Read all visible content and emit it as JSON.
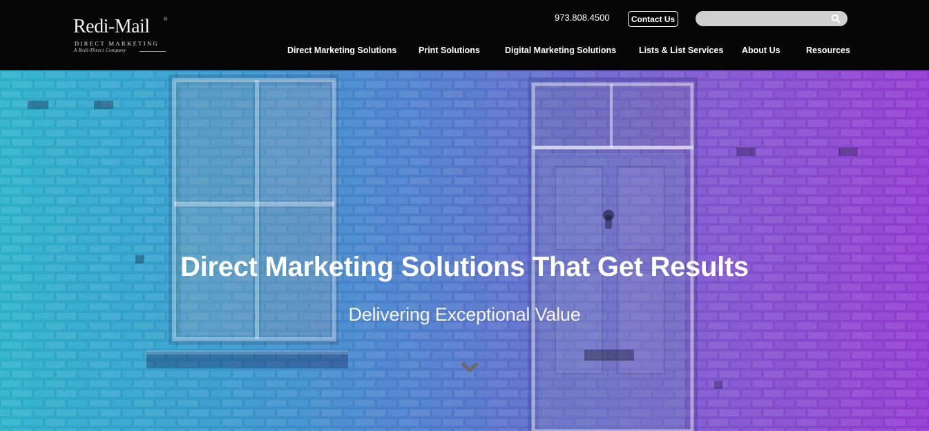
{
  "brand": {
    "name": "Redi-Mail",
    "registered": "®",
    "tagline": "DIRECT MARKETING",
    "parent": "A Redi-Direct Company"
  },
  "header": {
    "phone": "973.808.4500",
    "contact_label": "Contact Us",
    "search_placeholder": ""
  },
  "nav": [
    {
      "label": "Direct Marketing Solutions"
    },
    {
      "label": "Print Solutions"
    },
    {
      "label": "Digital Marketing Solutions"
    },
    {
      "label": "Lists & List Services"
    },
    {
      "label": "About Us"
    },
    {
      "label": "Resources"
    }
  ],
  "hero": {
    "title": "Direct Marketing Solutions That Get Results",
    "subtitle": "Delivering Exceptional Value",
    "gradient_start": "#2ec6dc",
    "gradient_end": "#a23fe2"
  },
  "icons": {
    "search": "search-icon",
    "scroll_down": "chevron-down-icon"
  }
}
